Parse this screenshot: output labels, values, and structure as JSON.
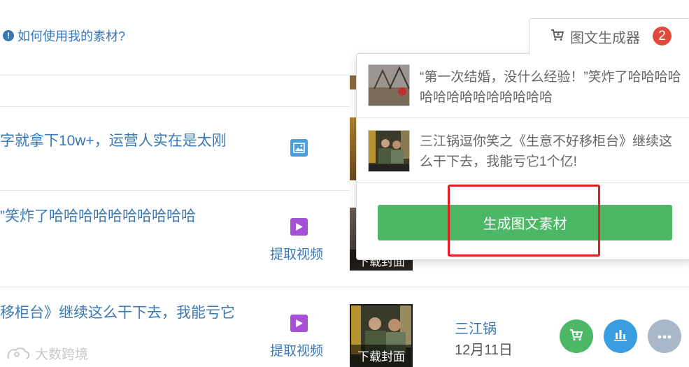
{
  "help": {
    "text": "如何使用我的素材?"
  },
  "rows": [
    {
      "title": "字就拿下10w+，运营人实在是太刚",
      "type": "image"
    },
    {
      "title": "”笑炸了哈哈哈哈哈哈哈哈哈哈",
      "type": "video",
      "action": "提取视频",
      "cover_label": "下载封面"
    },
    {
      "title": "移柜台》继续这么干下去，我能亏它",
      "type": "video",
      "action": "提取视频",
      "cover_label": "下载封面",
      "author": "三江锅",
      "date": "12月11日"
    }
  ],
  "row_actions": {
    "cart_icon": "cart-icon",
    "chart_icon": "chart-icon",
    "more_icon": "more-icon"
  },
  "generator": {
    "tab_label": "图文生成器",
    "count": "2",
    "items": [
      {
        "title": "“第一次结婚，没什么经验！”笑炸了哈哈哈哈哈哈哈哈哈哈哈哈哈哈"
      },
      {
        "title": "三江锅逗你笑之《生意不好移柜台》继续这么干下去，我能亏它1个亿!"
      }
    ],
    "button_label": "生成图文素材"
  },
  "watermark": {
    "text": "大数跨境"
  },
  "colors": {
    "accent": "#3a78b5",
    "green": "#4cb865",
    "badge": "#e04a3d",
    "highlight": "#e02020"
  }
}
